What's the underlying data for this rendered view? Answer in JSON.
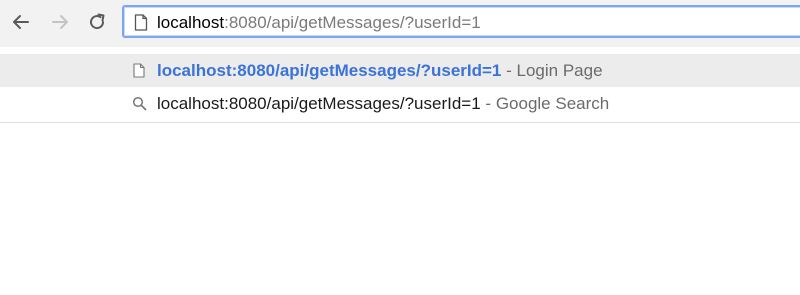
{
  "toolbar": {
    "back_icon": "arrow-left-icon",
    "forward_icon": "arrow-right-icon",
    "reload_icon": "reload-icon",
    "colors": {
      "background": "#f2f2f2",
      "focus_ring": "#7aa7f0"
    }
  },
  "omnibox": {
    "icon": "page-icon",
    "host": "localhost",
    "rest": ":8080/api/getMessages/?userId=1"
  },
  "suggestions": [
    {
      "icon": "page-icon",
      "url": "localhost:8080/api/getMessages/?userId=1",
      "separator": " - ",
      "description": "Login Page",
      "selected": true
    },
    {
      "icon": "search-icon",
      "url": "localhost:8080/api/getMessages/?userId=1",
      "separator": " - ",
      "description": "Google Search",
      "selected": false
    }
  ],
  "colors": {
    "link_blue": "#3b73d8",
    "muted_gray": "#7a7a7a"
  }
}
